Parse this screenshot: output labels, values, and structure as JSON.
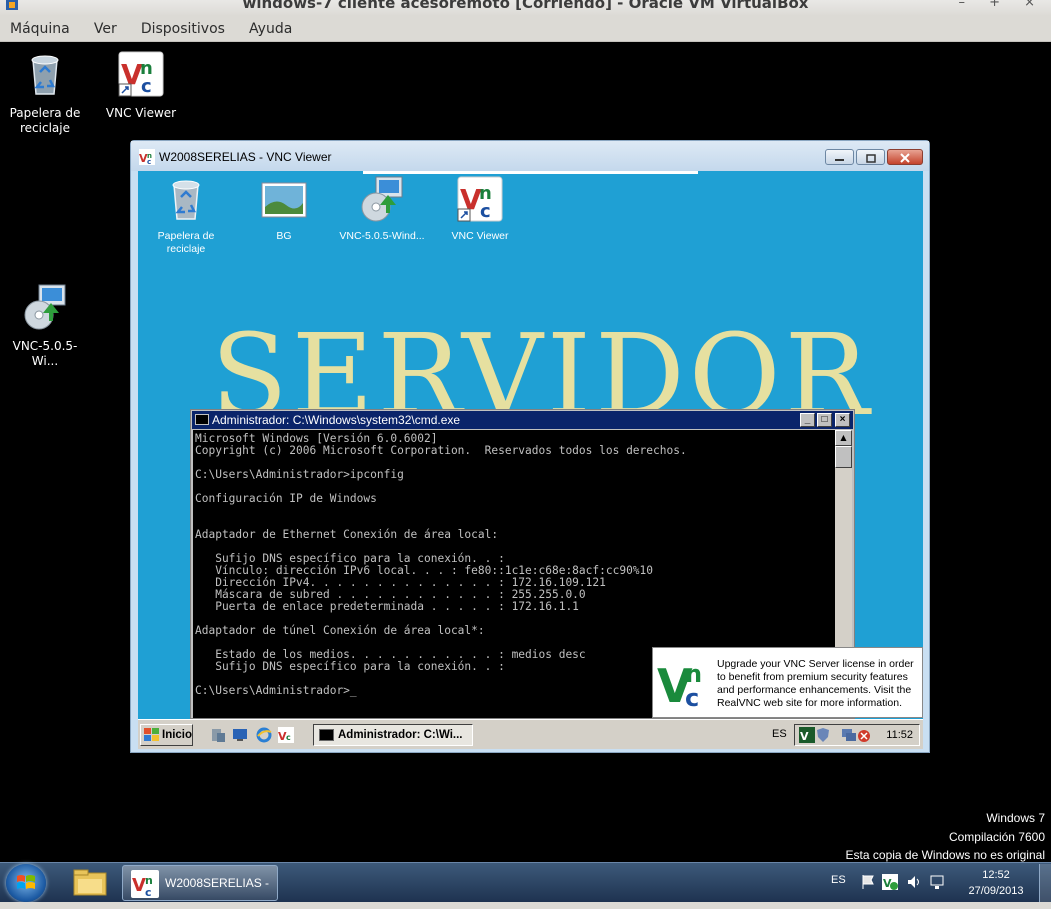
{
  "vbox": {
    "title": "windows-7 cliente acesoremoto  [Corriendo] - Oracle VM VirtualBox",
    "menu": [
      "Máquina",
      "Ver",
      "Dispositivos",
      "Ayuda"
    ],
    "window_buttons": "– + ×"
  },
  "host_desktop": {
    "icons": [
      {
        "label": "Papelera de reciclaje",
        "icon": "recycle-bin-icon"
      },
      {
        "label": "VNC Viewer",
        "icon": "vnc-viewer-icon"
      },
      {
        "label": "VNC-5.0.5-Wi...",
        "icon": "installer-icon"
      }
    ],
    "watermark": [
      "Windows 7",
      "Compilación  7600",
      "Esta copia de Windows no es original"
    ]
  },
  "vnc_window": {
    "title": "W2008SERELIAS - VNC Viewer"
  },
  "remote_desktop": {
    "icons": [
      {
        "label": "Papelera de reciclaje",
        "icon": "recycle-bin-icon"
      },
      {
        "label": "BG",
        "icon": "image-icon"
      },
      {
        "label": "VNC-5.0.5-Wind...",
        "icon": "installer-icon"
      },
      {
        "label": "VNC Viewer",
        "icon": "vnc-viewer-icon"
      }
    ],
    "wallpaper_text": "SERVIDOR"
  },
  "cmd": {
    "title": "Administrador: C:\\Windows\\system32\\cmd.exe",
    "lines": [
      "Microsoft Windows [Versión 6.0.6002]",
      "Copyright (c) 2006 Microsoft Corporation.  Reservados todos los derechos.",
      "",
      "C:\\Users\\Administrador>ipconfig",
      "",
      "Configuración IP de Windows",
      "",
      "",
      "Adaptador de Ethernet Conexión de área local:",
      "",
      "   Sufijo DNS específico para la conexión. . :",
      "   Vínculo: dirección IPv6 local. . . : fe80::1c1e:c68e:8acf:cc90%10",
      "   Dirección IPv4. . . . . . . . . . . . . . : 172.16.109.121",
      "   Máscara de subred . . . . . . . . . . . . : 255.255.0.0",
      "   Puerta de enlace predeterminada . . . . . : 172.16.1.1",
      "",
      "Adaptador de túnel Conexión de área local*:",
      "",
      "   Estado de los medios. . . . . . . . . . . : medios desc",
      "   Sufijo DNS específico para la conexión. . :",
      "",
      "C:\\Users\\Administrador>_"
    ]
  },
  "upgrade_popup": {
    "text": "Upgrade your VNC Server license in order to benefit from premium security features and performance enhancements. Visit the RealVNC web site for more information."
  },
  "remote_taskbar": {
    "start_label": "Inicio",
    "task_label": "Administrador: C:\\Wi...",
    "lang": "ES",
    "clock": "11:52"
  },
  "host_taskbar": {
    "task_label": "W2008SERELIAS - ...",
    "lang": "ES",
    "time": "12:52",
    "date": "27/09/2013"
  },
  "colors": {
    "remote_wallpaper": "#1fa0d4",
    "wallpaper_text": "#e6e0a0",
    "cmd_bg": "#000000",
    "cmd_text": "#c0c0c0"
  }
}
